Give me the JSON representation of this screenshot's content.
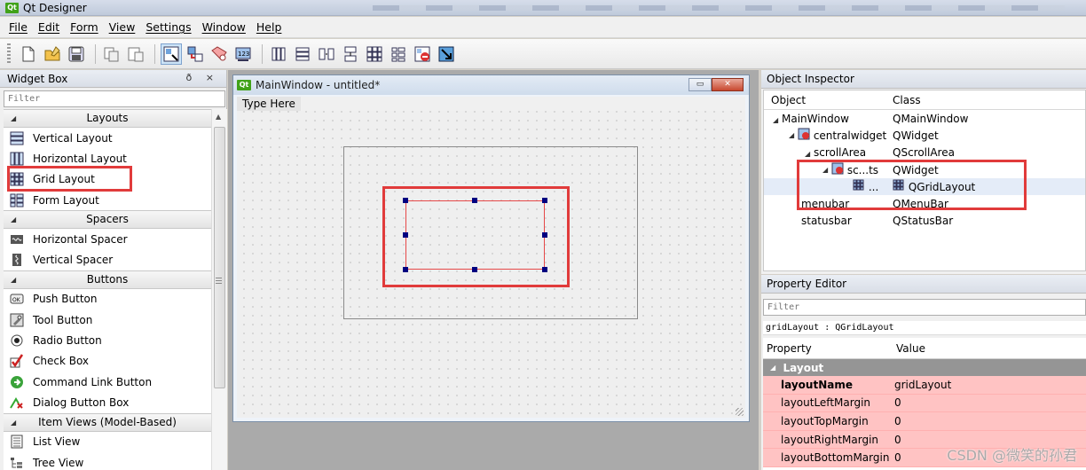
{
  "window": {
    "title": "Qt Designer",
    "badge": "Qt"
  },
  "menu": [
    "File",
    "Edit",
    "Form",
    "View",
    "Settings",
    "Window",
    "Help"
  ],
  "widget_box": {
    "title": "Widget Box",
    "controls": "ð ×",
    "filter_placeholder": "Filter",
    "categories": {
      "layouts": "Layouts",
      "spacers": "Spacers",
      "buttons": "Buttons",
      "item_views": "Item Views (Model-Based)"
    },
    "layout_items": [
      "Vertical Layout",
      "Horizontal Layout",
      "Grid Layout",
      "Form Layout"
    ],
    "spacer_items": [
      "Horizontal Spacer",
      "Vertical Spacer"
    ],
    "button_items": [
      "Push Button",
      "Tool Button",
      "Radio Button",
      "Check Box",
      "Command Link Button",
      "Dialog Button Box"
    ],
    "view_items": [
      "List View",
      "Tree View"
    ]
  },
  "sub_window": {
    "title": "MainWindow - untitled*",
    "badge": "Qt",
    "menu_placeholder": "Type Here"
  },
  "object_inspector": {
    "title": "Object Inspector",
    "col_object": "Object",
    "col_class": "Class",
    "rows": [
      {
        "object": "MainWindow",
        "class": "QMainWindow"
      },
      {
        "object": "centralwidget",
        "class": "QWidget"
      },
      {
        "object": "scrollArea",
        "class": "QScrollArea"
      },
      {
        "object": "sc...ts",
        "class": "QWidget"
      },
      {
        "object": "...",
        "class": "QGridLayout"
      },
      {
        "object": "menubar",
        "class": "QMenuBar"
      },
      {
        "object": "statusbar",
        "class": "QStatusBar"
      }
    ]
  },
  "property_editor": {
    "title": "Property Editor",
    "filter_placeholder": "Filter",
    "class_line": "gridLayout : QGridLayout",
    "col_property": "Property",
    "col_value": "Value",
    "section": "Layout",
    "rows": [
      {
        "name": "layoutName",
        "value": "gridLayout"
      },
      {
        "name": "layoutLeftMargin",
        "value": "0"
      },
      {
        "name": "layoutTopMargin",
        "value": "0"
      },
      {
        "name": "layoutRightMargin",
        "value": "0"
      },
      {
        "name": "layoutBottomMargin",
        "value": "0"
      }
    ]
  },
  "watermark": "CSDN @微笑的孙君",
  "colors": {
    "highlight_box": "#e13b3b",
    "property_row": "#ffc3c3",
    "section_bg": "#959595"
  }
}
